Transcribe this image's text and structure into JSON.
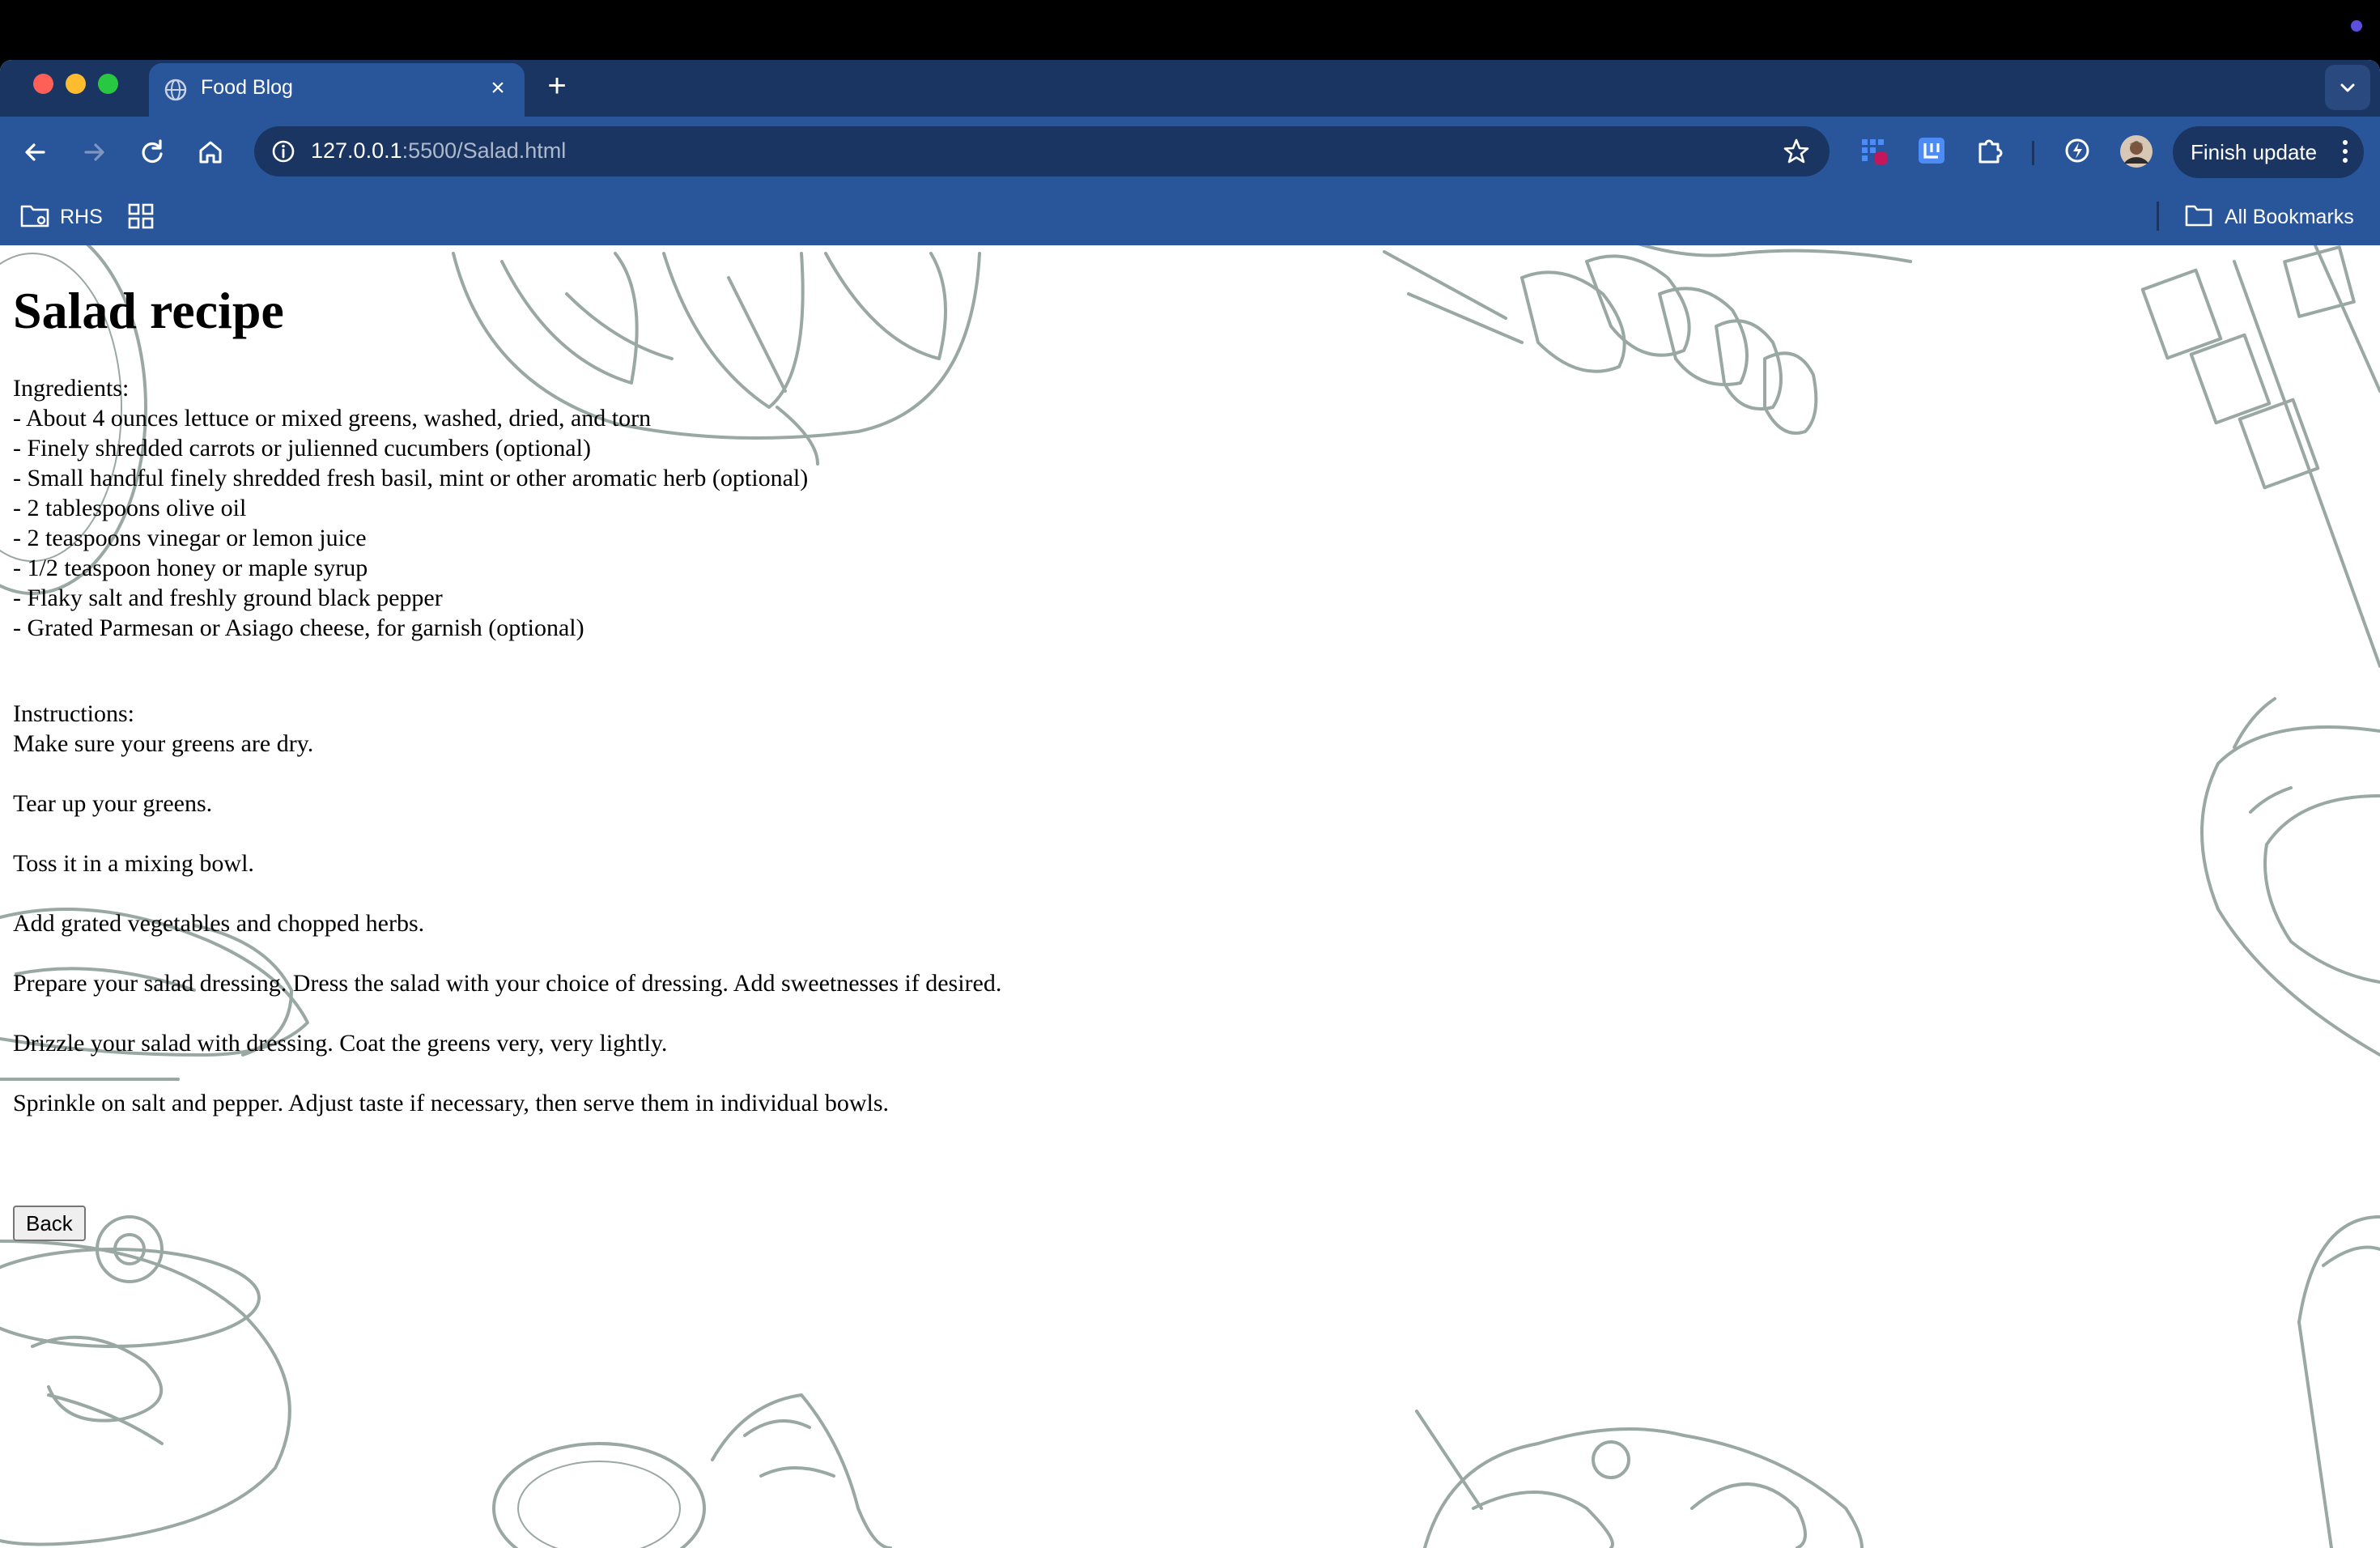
{
  "browser": {
    "tab": {
      "title": "Food Blog",
      "close_symbol": "×"
    },
    "new_tab_symbol": "+",
    "url": {
      "host": "127.0.0.1",
      "path": ":5500/Salad.html"
    },
    "finish_update_label": "Finish update",
    "bookmarks": {
      "folder_label": "RHS",
      "all_bookmarks_label": "All Bookmarks"
    }
  },
  "page": {
    "title": "Salad recipe",
    "ingredients_heading": "Ingredients:",
    "ingredients": [
      "- About 4 ounces lettuce or mixed greens, washed, dried, and torn",
      "- Finely shredded carrots or julienned cucumbers (optional)",
      "- Small handful finely shredded fresh basil, mint or other aromatic herb (optional)",
      "- 2 tablespoons olive oil",
      "- 2 teaspoons vinegar or lemon juice",
      "- 1/2 teaspoon honey or maple syrup",
      "- Flaky salt and freshly ground black pepper",
      "- Grated Parmesan or Asiago cheese, for garnish (optional)"
    ],
    "instructions_heading": "Instructions:",
    "instructions": [
      "Make sure your greens are dry.",
      "Tear up your greens.",
      "Toss it in a mixing bowl.",
      "Add grated vegetables and chopped herbs.",
      "Prepare your salad dressing. Dress the salad with your choice of dressing. Add sweetnesses if desired.",
      "Drizzle your salad with dressing. Coat the greens very, very lightly.",
      "Sprinkle on salt and pepper. Adjust taste if necessary, then serve them in individual bowls."
    ],
    "back_button_label": "Back"
  },
  "colors": {
    "tabstrip": "#1b3562",
    "toolbar": "#29559a",
    "sketch": "#9aa8a4"
  }
}
